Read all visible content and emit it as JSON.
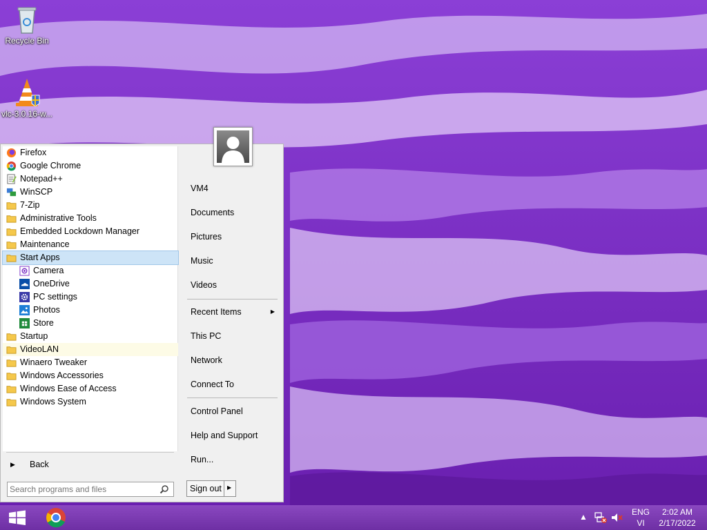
{
  "desktop": {
    "icons": [
      {
        "label": "Recycle Bin",
        "icon": "recycle-bin-icon"
      },
      {
        "label": "vlc-3.0.16-w...",
        "icon": "vlc-cone-icon"
      }
    ]
  },
  "start_menu": {
    "programs": [
      {
        "label": "Firefox",
        "icon": "firefox-icon"
      },
      {
        "label": "Google Chrome",
        "icon": "chrome-icon"
      },
      {
        "label": "Notepad++",
        "icon": "notepad-plus-plus-icon"
      },
      {
        "label": "WinSCP",
        "icon": "winscp-icon"
      },
      {
        "label": "7-Zip",
        "icon": "folder-icon"
      },
      {
        "label": "Administrative Tools",
        "icon": "folder-icon"
      },
      {
        "label": "Embedded Lockdown Manager",
        "icon": "folder-icon"
      },
      {
        "label": "Maintenance",
        "icon": "folder-icon"
      },
      {
        "label": "Start Apps",
        "icon": "folder-icon",
        "state": "selected"
      },
      {
        "label": "Camera",
        "icon": "camera-icon",
        "sub": true
      },
      {
        "label": "OneDrive",
        "icon": "onedrive-icon",
        "sub": true
      },
      {
        "label": "PC settings",
        "icon": "gear-icon",
        "sub": true
      },
      {
        "label": "Photos",
        "icon": "photos-icon",
        "sub": true
      },
      {
        "label": "Store",
        "icon": "store-icon",
        "sub": true
      },
      {
        "label": "Startup",
        "icon": "folder-icon"
      },
      {
        "label": "VideoLAN",
        "icon": "folder-icon",
        "state": "hover"
      },
      {
        "label": "Winaero Tweaker",
        "icon": "folder-icon"
      },
      {
        "label": "Windows Accessories",
        "icon": "folder-icon"
      },
      {
        "label": "Windows Ease of Access",
        "icon": "folder-icon"
      },
      {
        "label": "Windows System",
        "icon": "folder-icon"
      }
    ],
    "back_label": "Back",
    "search_placeholder": "Search programs and files",
    "right_items": {
      "user": "VM4",
      "documents": "Documents",
      "pictures": "Pictures",
      "music": "Music",
      "videos": "Videos",
      "recent_items": "Recent Items",
      "this_pc": "This PC",
      "network": "Network",
      "connect_to": "Connect To",
      "control_panel": "Control Panel",
      "help_support": "Help and Support",
      "run": "Run..."
    },
    "sign_out_label": "Sign out"
  },
  "taskbar": {
    "pinned": [
      "windows-logo-icon",
      "chrome-icon"
    ],
    "tray": {
      "language": "ENG",
      "input_method": "VI",
      "time": "2:02 AM",
      "date": "2/17/2022"
    }
  },
  "colors": {
    "wallpaper_base": "#7a2fc4",
    "selection": "#cde4f7",
    "taskbar": "#7c3bb2"
  }
}
